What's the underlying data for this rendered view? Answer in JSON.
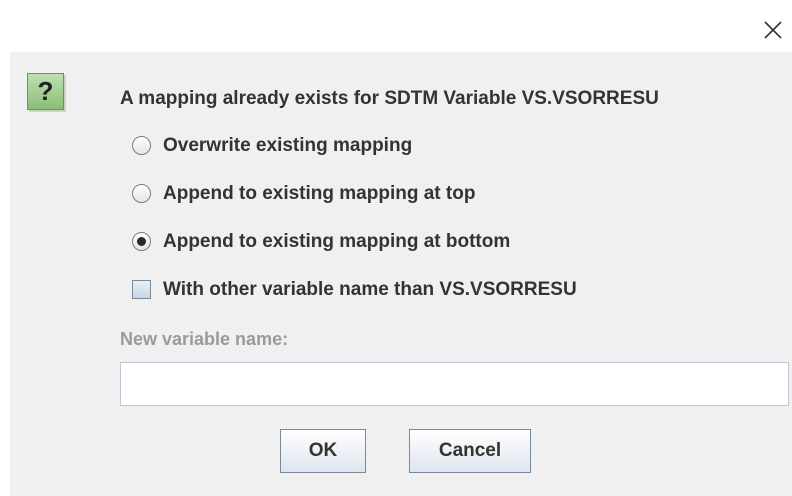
{
  "window": {
    "close_icon": "close-icon"
  },
  "dialog": {
    "icon": "question-icon",
    "icon_glyph": "?",
    "message": "A mapping already exists for SDTM Variable VS.VSORRESU",
    "options": [
      {
        "label": "Overwrite existing mapping",
        "selected": false
      },
      {
        "label": "Append to existing mapping at top",
        "selected": false
      },
      {
        "label": "Append to existing mapping at bottom",
        "selected": true
      }
    ],
    "checkbox": {
      "label": "With other variable name than VS.VSORRESU",
      "checked": false
    },
    "new_variable": {
      "label": "New variable name:",
      "value": ""
    },
    "buttons": {
      "ok": "OK",
      "cancel": "Cancel"
    }
  },
  "colors": {
    "background": "#f0f0f0",
    "icon_green": "#8cbd78",
    "disabled_text": "#9a9a9a"
  }
}
